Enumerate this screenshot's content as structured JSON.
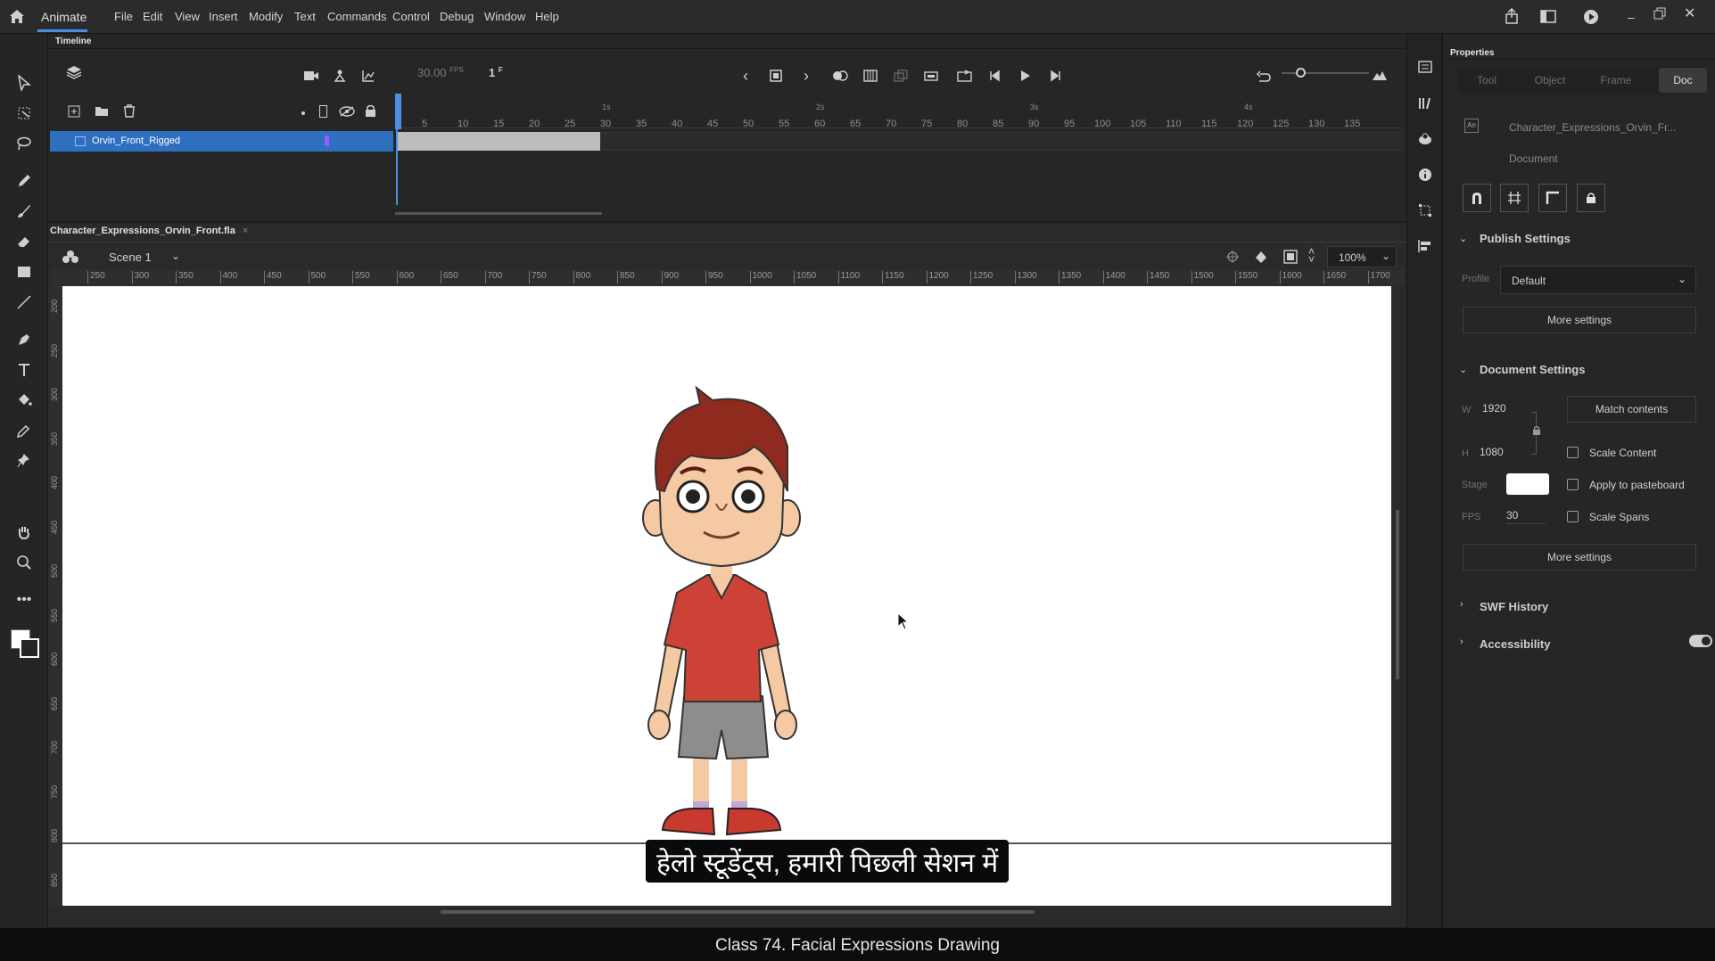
{
  "app": {
    "name": "Animate"
  },
  "menu": [
    "File",
    "Edit",
    "View",
    "Insert",
    "Modify",
    "Text",
    "Commands",
    "Control",
    "Debug",
    "Window",
    "Help"
  ],
  "timeline": {
    "title": "Timeline",
    "fps": "30.00",
    "fps_unit": "FPS",
    "current_frame": "1",
    "frame_unit": "F",
    "layer_name": "Orvin_Front_Rigged",
    "ruler_ticks": [
      "5",
      "10",
      "15",
      "20",
      "25",
      "30",
      "35",
      "40",
      "45",
      "50",
      "55",
      "60",
      "65",
      "70",
      "75",
      "80",
      "85",
      "90",
      "95",
      "100",
      "105",
      "110",
      "115",
      "120",
      "125",
      "130",
      "135"
    ],
    "second_marks": [
      "1s",
      "2s",
      "3s",
      "4s"
    ]
  },
  "document": {
    "tab": "Character_Expressions_Orvin_Front.fla",
    "scene": "Scene 1",
    "zoom": "100%",
    "hruler": [
      "250",
      "300",
      "350",
      "400",
      "450",
      "500",
      "550",
      "600",
      "650",
      "700",
      "750",
      "800",
      "850",
      "900",
      "950",
      "1000",
      "1050",
      "1100",
      "1150",
      "1200",
      "1250",
      "1300",
      "1350",
      "1400",
      "1450",
      "1500",
      "1550",
      "1600",
      "1650",
      "1700"
    ],
    "vruler": [
      "200",
      "250",
      "300",
      "350",
      "400",
      "450",
      "500",
      "550",
      "600",
      "650",
      "700",
      "750",
      "800",
      "850"
    ]
  },
  "properties": {
    "title": "Properties",
    "tabs": [
      "Tool",
      "Object",
      "Frame",
      "Doc"
    ],
    "active_tab": "Doc",
    "doc_name": "Character_Expressions_Orvin_Fr...",
    "doc_type": "Document",
    "publish_settings": {
      "title": "Publish Settings",
      "profile_label": "Profile",
      "profile": "Default",
      "more": "More settings"
    },
    "document_settings": {
      "title": "Document Settings",
      "w_label": "W",
      "w": "1920",
      "h_label": "H",
      "h": "1080",
      "match": "Match contents",
      "scale_content": "Scale Content",
      "stage_label": "Stage",
      "stage_color": "#ffffff",
      "apply_pasteboard": "Apply to pasteboard",
      "fps_label": "FPS",
      "fps": "30",
      "scale_spans": "Scale Spans",
      "more": "More settings"
    },
    "swf_history": "SWF History",
    "accessibility": "Accessibility"
  },
  "subtitle": "हेलो स्टूडेंट्स, हमारी पिछली सेशन में",
  "caption": "Class 74. Facial Expressions Drawing",
  "colors": {
    "accent": "#2f6fc0",
    "playhead": "#4a90e2",
    "layer_marker": "#9b59ff"
  }
}
